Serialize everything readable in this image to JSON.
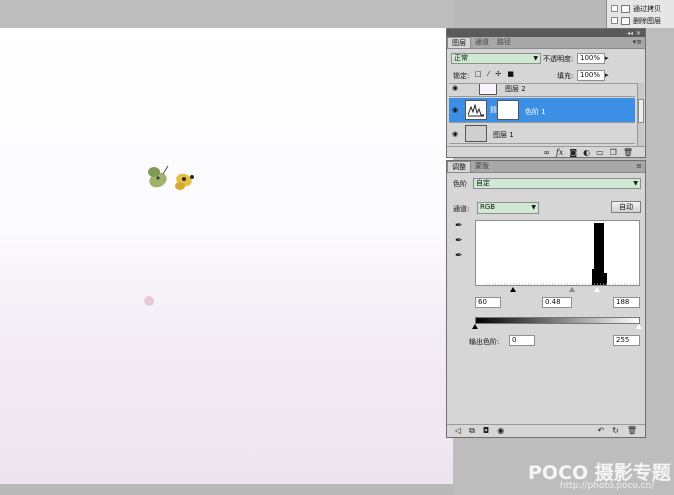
{
  "history": {
    "items": [
      "通过拷贝",
      "删除图层"
    ]
  },
  "layers_panel": {
    "tabs": [
      "图层",
      "通道",
      "路径"
    ],
    "blend_mode": "正常",
    "opacity_label": "不透明度:",
    "opacity_value": "100%",
    "lock_label": "锁定:",
    "fill_label": "填充:",
    "fill_value": "100%",
    "layers": [
      {
        "name": "图层 2",
        "selected": false
      },
      {
        "name": "色阶 1",
        "selected": true
      },
      {
        "name": "图层 1",
        "selected": false
      }
    ],
    "footer_icons": [
      "link-icon",
      "fx-icon",
      "mask-icon",
      "adjustment-icon",
      "group-icon",
      "new-layer-icon",
      "trash-icon"
    ]
  },
  "adjustments_panel": {
    "tabs": [
      "调整",
      "蒙版"
    ],
    "title": "色阶",
    "preset": "自定",
    "channel_label": "通道:",
    "channel_value": "RGB",
    "auto_button": "自动",
    "input_black": "60",
    "input_gray": "0.48",
    "input_white": "188",
    "output_label": "输出色阶:",
    "output_black": "0",
    "output_white": "255"
  },
  "watermark": {
    "brand": "POCO 摄影专题",
    "url": "http://photo.poco.cn/"
  },
  "colors": {
    "selection": "#3c8fe4",
    "field_green": "#cfe9d2"
  }
}
